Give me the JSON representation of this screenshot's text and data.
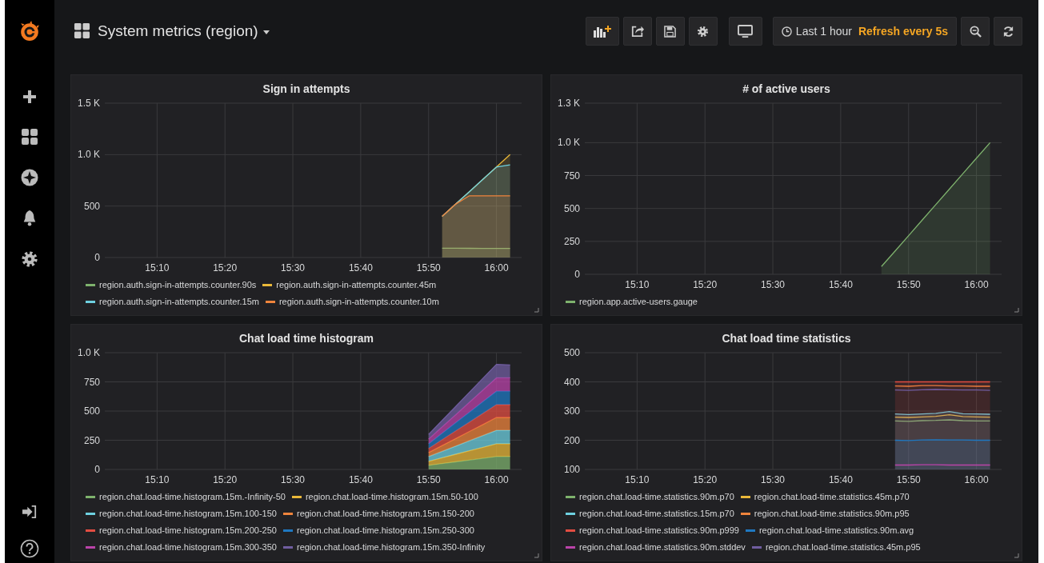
{
  "header": {
    "title": "System metrics (region)",
    "time_range": "Last 1 hour",
    "refresh": "Refresh every 5s"
  },
  "panels": [
    {
      "title": "Sign in attempts",
      "chart_data": {
        "type": "area",
        "stacked": false,
        "grid": true,
        "ylim": [
          0,
          1500
        ],
        "categories": [
          null,
          null,
          null,
          "15:10",
          null,
          null,
          null,
          null,
          "15:20",
          null,
          null,
          null,
          null,
          "15:30",
          null,
          null,
          null,
          null,
          "15:40",
          null,
          null,
          null,
          null,
          "15:50",
          null,
          null,
          null,
          null,
          "16:00",
          null
        ],
        "yticks": [
          0,
          500,
          {
            "value": 1000,
            "label": "1.0 K"
          },
          {
            "value": 1500,
            "label": "1.5 K"
          }
        ],
        "series": [
          {
            "name": "region.auth.sign-in-attempts.counter.90s",
            "color": "#7eb26d",
            "values": [
              null,
              null,
              null,
              null,
              null,
              null,
              null,
              null,
              null,
              null,
              null,
              null,
              null,
              null,
              null,
              null,
              null,
              null,
              null,
              null,
              null,
              null,
              null,
              null,
              90,
              90,
              89,
              88,
              88,
              88
            ]
          },
          {
            "name": "region.auth.sign-in-attempts.counter.45m",
            "color": "#eab839",
            "values": [
              null,
              null,
              null,
              null,
              null,
              null,
              null,
              null,
              null,
              null,
              null,
              null,
              null,
              null,
              null,
              null,
              null,
              null,
              null,
              null,
              null,
              null,
              null,
              null,
              400,
              520,
              640,
              760,
              880,
              1000
            ]
          },
          {
            "name": "region.auth.sign-in-attempts.counter.15m",
            "color": "#6ed0e0",
            "values": [
              null,
              null,
              null,
              null,
              null,
              null,
              null,
              null,
              null,
              null,
              null,
              null,
              null,
              null,
              null,
              null,
              null,
              null,
              null,
              null,
              null,
              null,
              null,
              null,
              400,
              520,
              640,
              760,
              880,
              900
            ]
          },
          {
            "name": "region.auth.sign-in-attempts.counter.10m",
            "color": "#ef843c",
            "values": [
              null,
              null,
              null,
              null,
              null,
              null,
              null,
              null,
              null,
              null,
              null,
              null,
              null,
              null,
              null,
              null,
              null,
              null,
              null,
              null,
              null,
              null,
              null,
              null,
              400,
              520,
              600,
              600,
              600,
              600
            ]
          }
        ]
      }
    },
    {
      "title": "# of active users",
      "chart_data": {
        "type": "area",
        "stacked": false,
        "grid": true,
        "ylim": [
          0,
          1300
        ],
        "categories": [
          null,
          null,
          null,
          "15:10",
          null,
          null,
          null,
          null,
          "15:20",
          null,
          null,
          null,
          null,
          "15:30",
          null,
          null,
          null,
          null,
          "15:40",
          null,
          null,
          null,
          null,
          "15:50",
          null,
          null,
          null,
          null,
          "16:00",
          null
        ],
        "yticks": [
          0,
          250,
          500,
          750,
          {
            "value": 1000,
            "label": "1.0 K"
          },
          {
            "value": 1300,
            "label": "1.3 K"
          }
        ],
        "series": [
          {
            "name": "region.app.active-users.gauge",
            "color": "#7eb26d",
            "values": [
              null,
              null,
              null,
              null,
              null,
              null,
              null,
              null,
              null,
              null,
              null,
              null,
              null,
              null,
              null,
              null,
              null,
              null,
              null,
              null,
              null,
              59,
              176,
              294,
              412,
              529,
              647,
              765,
              882,
              1000
            ]
          }
        ]
      }
    },
    {
      "title": "Chat load time histogram",
      "chart_data": {
        "type": "area",
        "stacked": true,
        "grid": true,
        "ylim": [
          0,
          1000
        ],
        "categories": [
          null,
          null,
          null,
          "15:10",
          null,
          null,
          null,
          null,
          "15:20",
          null,
          null,
          null,
          null,
          "15:30",
          null,
          null,
          null,
          null,
          "15:40",
          null,
          null,
          null,
          null,
          "15:50",
          null,
          null,
          null,
          null,
          "16:00",
          null
        ],
        "yticks": [
          0,
          250,
          500,
          750,
          {
            "value": 1000,
            "label": "1.0 K"
          }
        ],
        "series": [
          {
            "name": "region.chat.load-time.histogram.15m.-Infinity-50",
            "color": "#7eb26d",
            "values": [
              null,
              null,
              null,
              null,
              null,
              null,
              null,
              null,
              null,
              null,
              null,
              null,
              null,
              null,
              null,
              null,
              null,
              null,
              null,
              null,
              null,
              null,
              null,
              35,
              50,
              65,
              80,
              95,
              110,
              110
            ]
          },
          {
            "name": "region.chat.load-time.histogram.15m.50-100",
            "color": "#eab839",
            "values": [
              null,
              null,
              null,
              null,
              null,
              null,
              null,
              null,
              null,
              null,
              null,
              null,
              null,
              null,
              null,
              null,
              null,
              null,
              null,
              null,
              null,
              null,
              null,
              35,
              50,
              65,
              80,
              95,
              110,
              110
            ]
          },
          {
            "name": "region.chat.load-time.histogram.15m.100-150",
            "color": "#6ed0e0",
            "values": [
              null,
              null,
              null,
              null,
              null,
              null,
              null,
              null,
              null,
              null,
              null,
              null,
              null,
              null,
              null,
              null,
              null,
              null,
              null,
              null,
              null,
              null,
              null,
              40,
              55,
              70,
              85,
              100,
              115,
              115
            ]
          },
          {
            "name": "region.chat.load-time.histogram.15m.150-200",
            "color": "#ef843c",
            "values": [
              null,
              null,
              null,
              null,
              null,
              null,
              null,
              null,
              null,
              null,
              null,
              null,
              null,
              null,
              null,
              null,
              null,
              null,
              null,
              null,
              null,
              null,
              null,
              35,
              50,
              65,
              80,
              95,
              110,
              110
            ]
          },
          {
            "name": "region.chat.load-time.histogram.15m.200-250",
            "color": "#e24d42",
            "values": [
              null,
              null,
              null,
              null,
              null,
              null,
              null,
              null,
              null,
              null,
              null,
              null,
              null,
              null,
              null,
              null,
              null,
              null,
              null,
              null,
              null,
              null,
              null,
              35,
              50,
              65,
              80,
              95,
              110,
              110
            ]
          },
          {
            "name": "region.chat.load-time.histogram.15m.250-300",
            "color": "#1f78c1",
            "values": [
              null,
              null,
              null,
              null,
              null,
              null,
              null,
              null,
              null,
              null,
              null,
              null,
              null,
              null,
              null,
              null,
              null,
              null,
              null,
              null,
              null,
              null,
              null,
              40,
              55,
              70,
              85,
              100,
              115,
              115
            ]
          },
          {
            "name": "region.chat.load-time.histogram.15m.300-350",
            "color": "#ba43a9",
            "values": [
              null,
              null,
              null,
              null,
              null,
              null,
              null,
              null,
              null,
              null,
              null,
              null,
              null,
              null,
              null,
              null,
              null,
              null,
              null,
              null,
              null,
              null,
              null,
              40,
              55,
              70,
              85,
              100,
              115,
              115
            ]
          },
          {
            "name": "region.chat.load-time.histogram.15m.350-Infinity",
            "color": "#705da0",
            "values": [
              null,
              null,
              null,
              null,
              null,
              null,
              null,
              null,
              null,
              null,
              null,
              null,
              null,
              null,
              null,
              null,
              null,
              null,
              null,
              null,
              null,
              null,
              null,
              40,
              55,
              70,
              85,
              100,
              115,
              110
            ]
          }
        ]
      }
    },
    {
      "title": "Chat load time statistics",
      "chart_data": {
        "type": "area",
        "stacked": false,
        "grid": true,
        "ylim": [
          100,
          500
        ],
        "categories": [
          null,
          null,
          null,
          "15:10",
          null,
          null,
          null,
          null,
          "15:20",
          null,
          null,
          null,
          null,
          "15:30",
          null,
          null,
          null,
          null,
          "15:40",
          null,
          null,
          null,
          null,
          "15:50",
          null,
          null,
          null,
          null,
          "16:00",
          null
        ],
        "yticks": [
          100,
          200,
          300,
          400,
          500
        ],
        "series": [
          {
            "name": "region.chat.load-time.statistics.90m.p70",
            "type": "line",
            "color": "#7eb26d",
            "values": [
              null,
              null,
              null,
              null,
              null,
              null,
              null,
              null,
              null,
              null,
              null,
              null,
              null,
              null,
              null,
              null,
              null,
              null,
              null,
              null,
              null,
              null,
              266,
              265,
              267,
              268,
              270,
              267,
              266,
              266
            ]
          },
          {
            "name": "region.chat.load-time.statistics.45m.p70",
            "type": "line",
            "color": "#eab839",
            "values": [
              null,
              null,
              null,
              null,
              null,
              null,
              null,
              null,
              null,
              null,
              null,
              null,
              null,
              null,
              null,
              null,
              null,
              null,
              null,
              null,
              null,
              null,
              279,
              278,
              280,
              282,
              287,
              281,
              280,
              279
            ]
          },
          {
            "name": "region.chat.load-time.statistics.15m.p70",
            "color": "#6ed0e0",
            "values": [
              null,
              null,
              null,
              null,
              null,
              null,
              null,
              null,
              null,
              null,
              null,
              null,
              null,
              null,
              null,
              null,
              null,
              null,
              null,
              null,
              null,
              null,
              290,
              288,
              290,
              292,
              298,
              291,
              290,
              289
            ]
          },
          {
            "name": "region.chat.load-time.statistics.90m.p95",
            "type": "line",
            "color": "#ef843c",
            "values": [
              null,
              null,
              null,
              null,
              null,
              null,
              null,
              null,
              null,
              null,
              null,
              null,
              null,
              null,
              null,
              null,
              null,
              null,
              null,
              null,
              null,
              null,
              386,
              385,
              387,
              387,
              386,
              386,
              385,
              385
            ]
          },
          {
            "name": "region.chat.load-time.statistics.90m.p999",
            "color": "#e24d42",
            "values": [
              null,
              null,
              null,
              null,
              null,
              null,
              null,
              null,
              null,
              null,
              null,
              null,
              null,
              null,
              null,
              null,
              null,
              null,
              null,
              null,
              null,
              null,
              400,
              400,
              400,
              400,
              400,
              400,
              400,
              400
            ]
          },
          {
            "name": "region.chat.load-time.statistics.90m.avg",
            "color": "#1f78c1",
            "values": [
              null,
              null,
              null,
              null,
              null,
              null,
              null,
              null,
              null,
              null,
              null,
              null,
              null,
              null,
              null,
              null,
              null,
              null,
              null,
              null,
              null,
              null,
              200,
              199,
              201,
              202,
              201,
              201,
              200,
              200
            ]
          },
          {
            "name": "region.chat.load-time.statistics.90m.stddev",
            "type": "line",
            "color": "#ba43a9",
            "values": [
              null,
              null,
              null,
              null,
              null,
              null,
              null,
              null,
              null,
              null,
              null,
              null,
              null,
              null,
              null,
              null,
              null,
              null,
              null,
              null,
              null,
              null,
              115,
              115,
              116,
              116,
              115,
              115,
              115,
              115
            ]
          },
          {
            "name": "region.chat.load-time.statistics.45m.p95",
            "type": "line",
            "color": "#705da0",
            "values": [
              null,
              null,
              null,
              null,
              null,
              null,
              null,
              null,
              null,
              null,
              null,
              null,
              null,
              null,
              null,
              null,
              null,
              null,
              null,
              null,
              null,
              null,
              372,
              371,
              373,
              374,
              373,
              372,
              372,
              371
            ]
          }
        ]
      }
    }
  ]
}
